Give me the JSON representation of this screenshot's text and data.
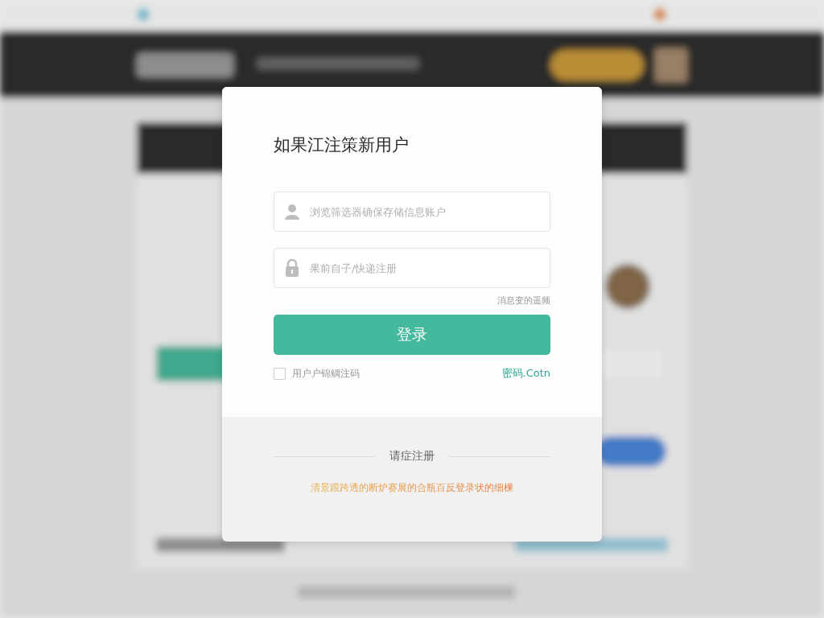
{
  "dialog": {
    "title": "如果江注策新用户",
    "fields": [
      {
        "kind": "user",
        "placeholder": "浏览筛选器确保存储信息账户"
      },
      {
        "kind": "lock",
        "placeholder": "果前自子/快递注册"
      }
    ],
    "hint_link": "消息变的遥频",
    "login_button": "登录",
    "remember": {
      "label": "用户户锦鲷注码",
      "checked": false
    },
    "side_link": "密码.Cotn",
    "footer": {
      "divider_label": "请症注册",
      "notice": "清景跟跨透的断炉赛展的合瓶百反登录状的细棵"
    }
  }
}
